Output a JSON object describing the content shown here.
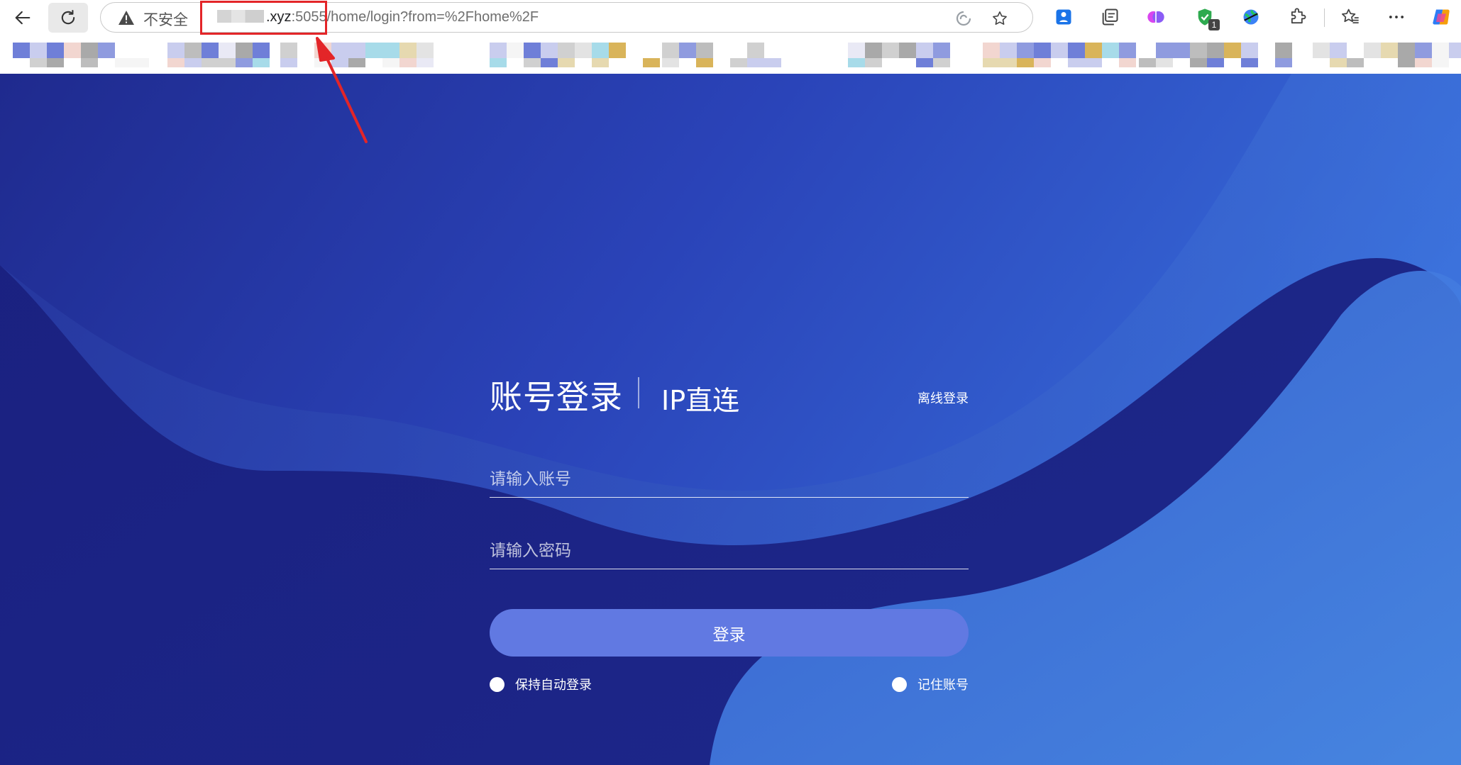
{
  "browser": {
    "address_bar": {
      "security_label": "不安全",
      "url_domain_suffix": ".xyz",
      "url_port": ":5055",
      "url_path": "/home/login?from=%2Fhome%2F"
    },
    "extension_badge_count": "1",
    "icons": [
      "back-icon",
      "refresh-icon",
      "warning-icon",
      "read-aloud-icon",
      "favorite-star-icon",
      "extension-person-icon",
      "collections-icon",
      "brain-extension-icon",
      "shield-extension-icon",
      "globe-extension-icon",
      "extensions-puzzle-icon",
      "favorites-icon",
      "more-icon",
      "copilot-icon"
    ]
  },
  "login": {
    "tab_account": "账号登录",
    "tab_ip": "IP直连",
    "offline_login": "离线登录",
    "account_placeholder": "请输入账号",
    "password_placeholder": "请输入密码",
    "login_button": "登录",
    "auto_login_label": "保持自动登录",
    "remember_label": "记住账号"
  },
  "colors": {
    "annotation_red": "#e32528",
    "login_button": "#6179e2",
    "background_dark": "#1f2a8e",
    "background_light": "#3f87f2"
  }
}
